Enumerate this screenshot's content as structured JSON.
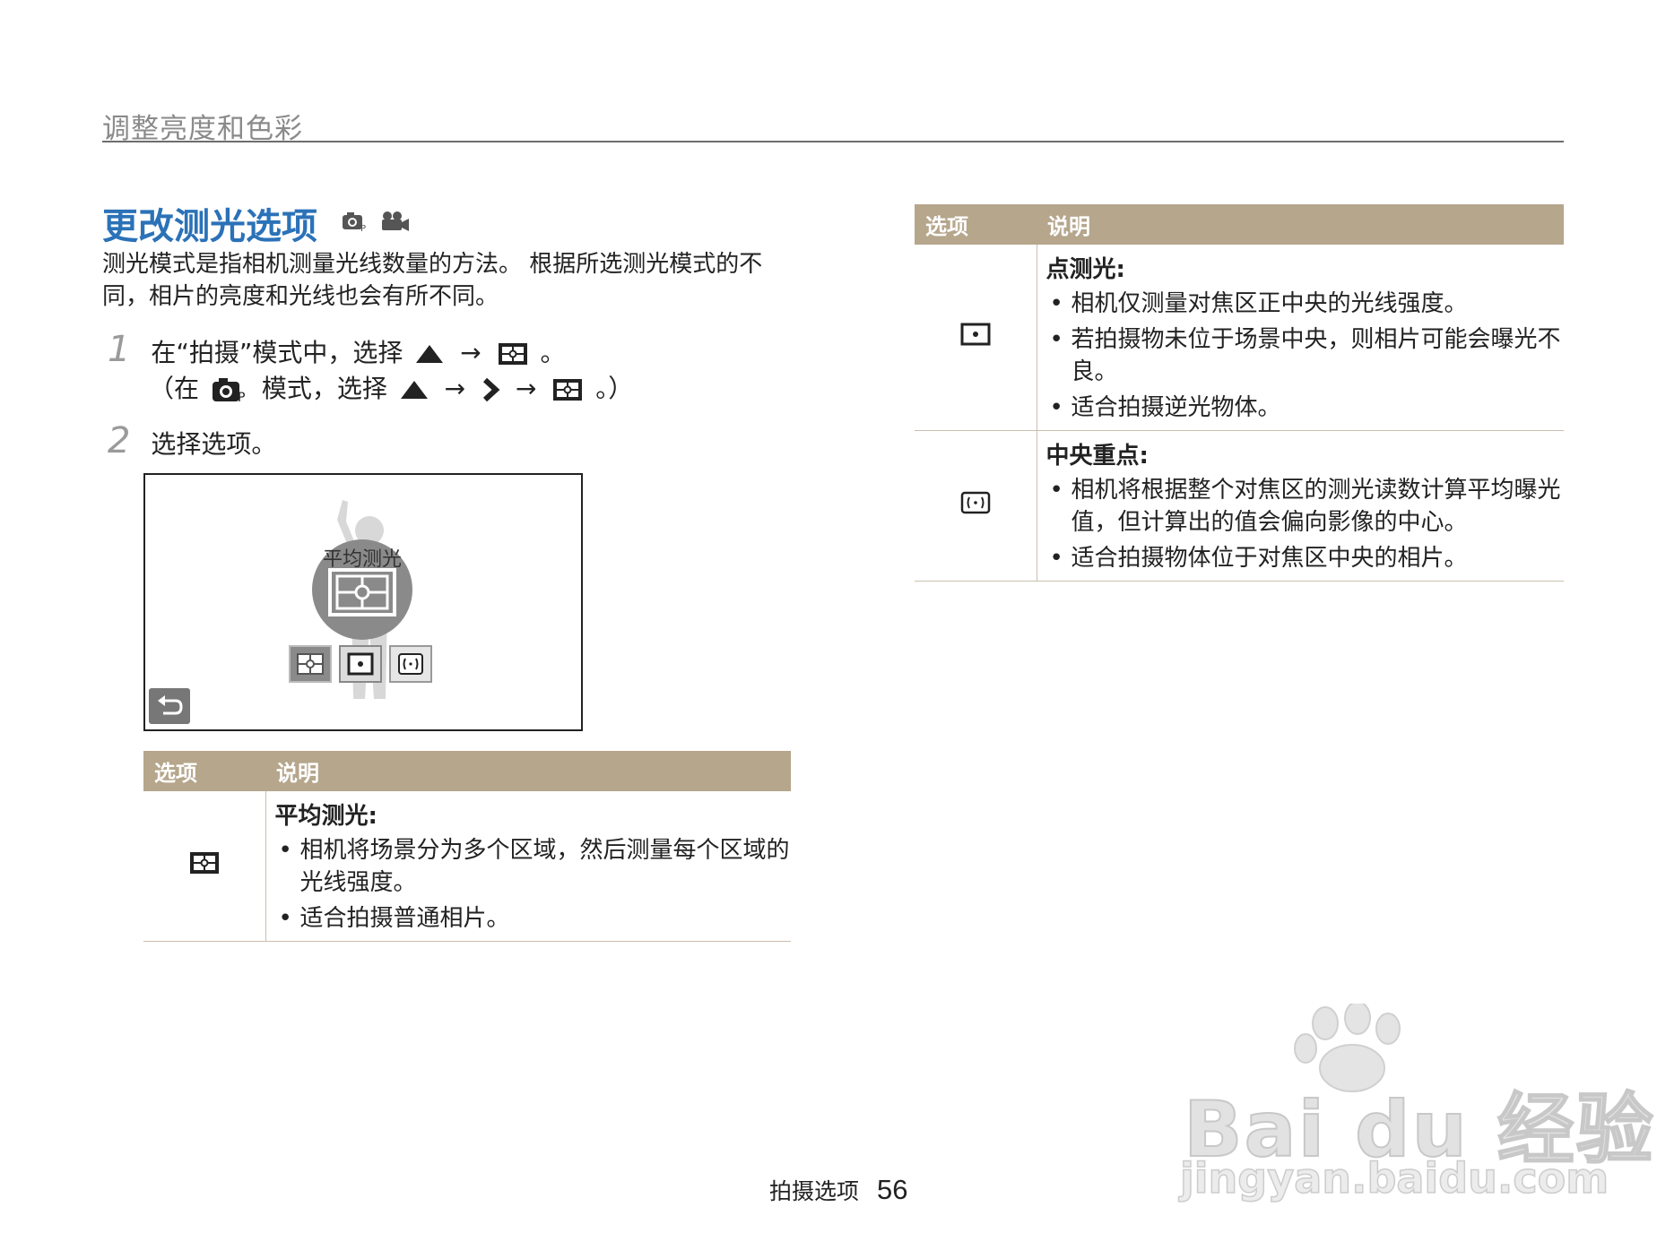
{
  "header": {
    "section": "调整亮度和色彩"
  },
  "title": "更改测光选项",
  "intro": "测光模式是指相机测量光线数量的方法。 根据所选测光模式的不同，相片的亮度和光线也会有所不同。",
  "steps": [
    {
      "num": "1",
      "text_a": "在“拍摄”模式中，选择",
      "text_b": "。",
      "sub_a": "（在",
      "sub_b": "模式，选择",
      "sub_c": "。）"
    },
    {
      "num": "2",
      "text": "选择选项。"
    }
  ],
  "screen": {
    "label": "平均测光"
  },
  "table_left": {
    "headers": [
      "选项",
      "说明"
    ],
    "rows": [
      {
        "icon": "multi-metering-icon",
        "name": "平均测光",
        "colon": ":",
        "bullets": [
          "相机将场景分为多个区域，然后测量每个区域的光线强度。",
          "适合拍摄普通相片。"
        ]
      }
    ]
  },
  "table_right": {
    "headers": [
      "选项",
      "说明"
    ],
    "rows": [
      {
        "icon": "spot-metering-icon",
        "name": "点测光",
        "colon": ":",
        "bullets": [
          "相机仅测量对焦区正中央的光线强度。",
          "若拍摄物未位于场景中央，则相片可能会曝光不良。",
          "适合拍摄逆光物体。"
        ]
      },
      {
        "icon": "center-weighted-metering-icon",
        "name": "中央重点",
        "colon": ":",
        "bullets": [
          "相机将根据整个对焦区的测光读数计算平均曝光值，但计算出的值会偏向影像的中心。",
          "适合拍摄物体位于对焦区中央的相片。"
        ]
      }
    ]
  },
  "arrows": "→",
  "footer": {
    "label": "拍摄选项",
    "page": "56"
  },
  "watermark": {
    "brand": "Bai du 经验",
    "url": "jingyan.baidu.com"
  },
  "colors": {
    "title": "#2b72b8",
    "table_header": "#b5a68c",
    "rule": "#6d6d6d"
  }
}
